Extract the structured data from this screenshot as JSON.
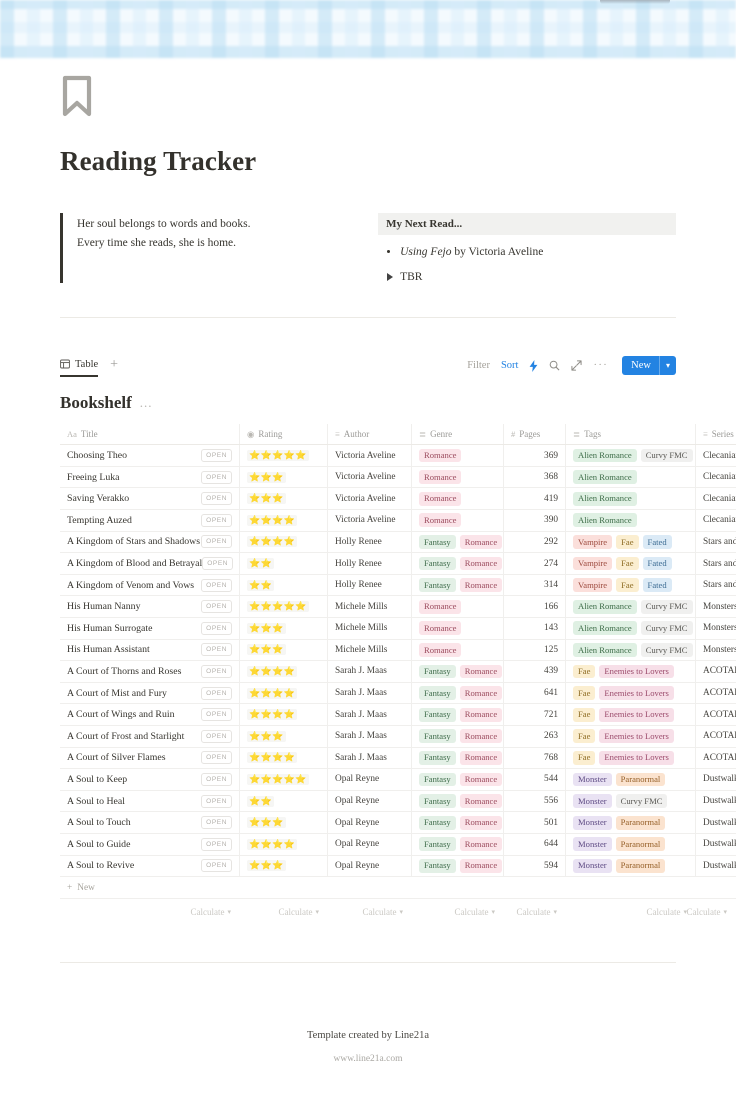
{
  "cover": {
    "icon": "bookmark-icon",
    "pattern": "blue-gingham",
    "accent": "#bade f3"
  },
  "page": {
    "title": "Reading Tracker",
    "quote_line1": "Her soul belongs to words and books.",
    "quote_line2": "Every time she reads, she is home."
  },
  "next_read": {
    "header": "My Next Read...",
    "bullet_title": "Using Fejo",
    "bullet_rest": " by Victoria Aveline",
    "toggle_label": "TBR"
  },
  "toolbar": {
    "tab_label": "Table",
    "add_view": "+",
    "filter_label": "Filter",
    "sort_label": "Sort",
    "lightning_icon": "lightning-icon",
    "search_icon": "search-icon",
    "expand_icon": "expand-icon",
    "more_icon": "more-horizontal-icon",
    "new_label": "New",
    "new_chevron": "chevron-down-icon",
    "accent_color": "#2383e2"
  },
  "database": {
    "title": "Bookshelf",
    "more_label": "...",
    "new_row_label": "New",
    "columns": [
      {
        "label": "Title",
        "icon": "text-icon",
        "icon_glyph": "Aa"
      },
      {
        "label": "Rating",
        "icon": "select-icon",
        "icon_glyph": "◉"
      },
      {
        "label": "Author",
        "icon": "list-icon",
        "icon_glyph": "≡"
      },
      {
        "label": "Genre",
        "icon": "multiselect-icon",
        "icon_glyph": "≣"
      },
      {
        "label": "Pages",
        "icon": "number-icon",
        "icon_glyph": "#"
      },
      {
        "label": "Tags",
        "icon": "multiselect-icon",
        "icon_glyph": "≣"
      },
      {
        "label": "Series",
        "icon": "list-icon",
        "icon_glyph": "≡"
      }
    ],
    "open_label": "OPEN",
    "calculate_label": "Calculate",
    "calculate_count": 6,
    "rows": [
      {
        "title": "Choosing Theo",
        "rating": 5,
        "author": "Victoria Aveline",
        "genre": [
          "Romance"
        ],
        "pages": 369,
        "tags": [
          "Alien Romance",
          "Curvy FMC"
        ],
        "series": "Clecanian S"
      },
      {
        "title": "Freeing Luka",
        "rating": 3,
        "author": "Victoria Aveline",
        "genre": [
          "Romance"
        ],
        "pages": 368,
        "tags": [
          "Alien Romance"
        ],
        "series": "Clecanian S"
      },
      {
        "title": "Saving Verakko",
        "rating": 3,
        "author": "Victoria Aveline",
        "genre": [
          "Romance"
        ],
        "pages": 419,
        "tags": [
          "Alien Romance"
        ],
        "series": "Clecanian S"
      },
      {
        "title": "Tempting Auzed",
        "rating": 4,
        "author": "Victoria Aveline",
        "genre": [
          "Romance"
        ],
        "pages": 390,
        "tags": [
          "Alien Romance"
        ],
        "series": "Clecanian S"
      },
      {
        "title": "A Kingdom of Stars and Shadows",
        "rating": 4,
        "author": "Holly Renee",
        "genre": [
          "Fantasy",
          "Romance"
        ],
        "pages": 292,
        "tags": [
          "Vampire",
          "Fae",
          "Fated"
        ],
        "series": "Stars and Sh"
      },
      {
        "title": "A Kingdom of Blood and Betrayal",
        "rating": 2,
        "author": "Holly Renee",
        "genre": [
          "Fantasy",
          "Romance"
        ],
        "pages": 274,
        "tags": [
          "Vampire",
          "Fae",
          "Fated"
        ],
        "series": "Stars and Sh"
      },
      {
        "title": "A Kingdom of Venom and Vows",
        "rating": 2,
        "author": "Holly Renee",
        "genre": [
          "Fantasy",
          "Romance"
        ],
        "pages": 314,
        "tags": [
          "Vampire",
          "Fae",
          "Fated"
        ],
        "series": "Stars and Sh"
      },
      {
        "title": "His Human Nanny",
        "rating": 5,
        "author": "Michele Mills",
        "genre": [
          "Romance"
        ],
        "pages": 166,
        "tags": [
          "Alien Romance",
          "Curvy FMC"
        ],
        "series": "Monsters Lo"
      },
      {
        "title": "His Human Surrogate",
        "rating": 3,
        "author": "Michele Mills",
        "genre": [
          "Romance"
        ],
        "pages": 143,
        "tags": [
          "Alien Romance",
          "Curvy FMC"
        ],
        "series": "Monsters Lo"
      },
      {
        "title": "His Human Assistant",
        "rating": 3,
        "author": "Michele Mills",
        "genre": [
          "Romance"
        ],
        "pages": 125,
        "tags": [
          "Alien Romance",
          "Curvy FMC"
        ],
        "series": "Monsters Lo"
      },
      {
        "title": "A Court of Thorns and Roses",
        "rating": 4,
        "author": "Sarah J. Maas",
        "genre": [
          "Fantasy",
          "Romance"
        ],
        "pages": 439,
        "tags": [
          "Fae",
          "Enemies to Lovers"
        ],
        "series": "ACOTAR"
      },
      {
        "title": "A Court of Mist and Fury",
        "rating": 4,
        "author": "Sarah J. Maas",
        "genre": [
          "Fantasy",
          "Romance"
        ],
        "pages": 641,
        "tags": [
          "Fae",
          "Enemies to Lovers"
        ],
        "series": "ACOTAR"
      },
      {
        "title": "A Court of Wings and Ruin",
        "rating": 4,
        "author": "Sarah J. Maas",
        "genre": [
          "Fantasy",
          "Romance"
        ],
        "pages": 721,
        "tags": [
          "Fae",
          "Enemies to Lovers"
        ],
        "series": "ACOTAR"
      },
      {
        "title": "A Court of Frost and Starlight",
        "rating": 3,
        "author": "Sarah J. Maas",
        "genre": [
          "Fantasy",
          "Romance"
        ],
        "pages": 263,
        "tags": [
          "Fae",
          "Enemies to Lovers"
        ],
        "series": "ACOTAR"
      },
      {
        "title": "A Court of Silver Flames",
        "rating": 4,
        "author": "Sarah J. Maas",
        "genre": [
          "Fantasy",
          "Romance"
        ],
        "pages": 768,
        "tags": [
          "Fae",
          "Enemies to Lovers"
        ],
        "series": "ACOTAR"
      },
      {
        "title": "A Soul to Keep",
        "rating": 5,
        "author": "Opal Reyne",
        "genre": [
          "Fantasy",
          "Romance"
        ],
        "pages": 544,
        "tags": [
          "Monster",
          "Paranormal"
        ],
        "series": "Dustwalker"
      },
      {
        "title": "A Soul to Heal",
        "rating": 2,
        "author": "Opal Reyne",
        "genre": [
          "Fantasy",
          "Romance"
        ],
        "pages": 556,
        "tags": [
          "Monster",
          "Curvy FMC"
        ],
        "series": "Dustwalker"
      },
      {
        "title": "A Soul to Touch",
        "rating": 3,
        "author": "Opal Reyne",
        "genre": [
          "Fantasy",
          "Romance"
        ],
        "pages": 501,
        "tags": [
          "Monster",
          "Paranormal"
        ],
        "series": "Dustwalker"
      },
      {
        "title": "A Soul to Guide",
        "rating": 4,
        "author": "Opal Reyne",
        "genre": [
          "Fantasy",
          "Romance"
        ],
        "pages": 644,
        "tags": [
          "Monster",
          "Paranormal"
        ],
        "series": "Dustwalker"
      },
      {
        "title": "A Soul to Revive",
        "rating": 3,
        "author": "Opal Reyne",
        "genre": [
          "Fantasy",
          "Romance"
        ],
        "pages": 594,
        "tags": [
          "Monster",
          "Paranormal"
        ],
        "series": "Dustwalker"
      }
    ]
  },
  "footer": {
    "credit": "Template created by Line21a",
    "url": "www.line21a.com"
  }
}
